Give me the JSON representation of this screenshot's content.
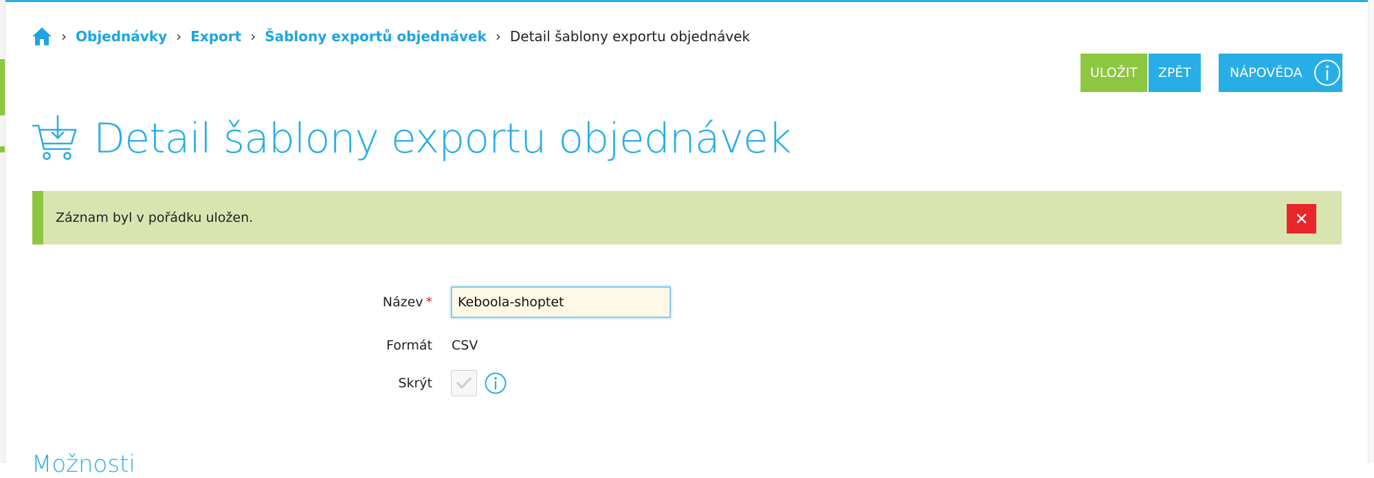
{
  "breadcrumb": {
    "home_icon": "home-icon",
    "items": [
      {
        "label": "Objednávky"
      },
      {
        "label": "Export"
      },
      {
        "label": "Šablony exportů objednávek"
      }
    ],
    "current": "Detail šablony exportu objednávek"
  },
  "toolbar": {
    "save_label": "ULOŽIT",
    "back_label": "ZPĚT",
    "help_label": "NÁPOVĚDA",
    "help_icon": "info-circle-icon"
  },
  "page": {
    "title": "Detail šablony exportu objednávek",
    "icon": "cart-download-icon"
  },
  "alert": {
    "message": "Záznam byl v pořádku uložen.",
    "close_label": "✕"
  },
  "form": {
    "name_label": "Název",
    "required_mark": "*",
    "name_value": "Keboola-shoptet",
    "format_label": "Formát",
    "format_value": "CSV",
    "hide_label": "Skrýt",
    "hide_checked": false
  },
  "section": {
    "heading": "Možnosti"
  },
  "colors": {
    "accent_blue": "#27aee6",
    "accent_green": "#8dc63f",
    "alert_bg": "#d9e5b0",
    "danger": "#e8262b"
  }
}
